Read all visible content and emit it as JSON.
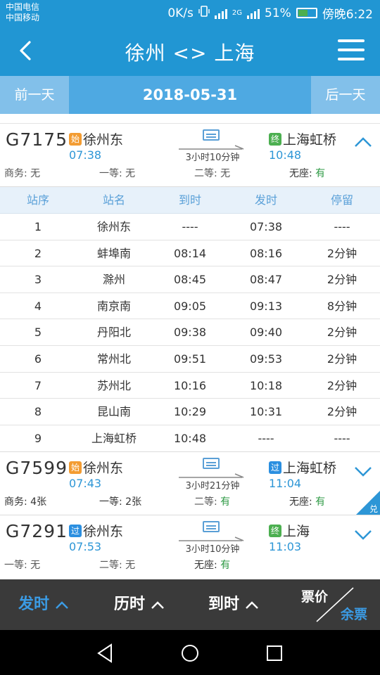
{
  "status_bar": {
    "carrier1": "中国电信",
    "carrier2": "中国移动",
    "speed": "0K/s",
    "net_label": "2G",
    "battery": "51%",
    "time": "傍晚6:22"
  },
  "app_bar": {
    "title": "徐州 <> 上海"
  },
  "date_bar": {
    "prev_label": "前一天",
    "date": "2018-05-31",
    "next_label": "后一天"
  },
  "trains": [
    {
      "code": "G7175",
      "from_tag": "始",
      "from": "徐州东",
      "dep_time": "07:38",
      "duration": "3小时10分钟",
      "to_tag": "终",
      "to": "上海虹桥",
      "arr_time": "10:48",
      "seats": [
        {
          "label": "商务: ",
          "value": "无"
        },
        {
          "label": "一等: ",
          "value": "无"
        },
        {
          "label": "二等: ",
          "value": "无"
        },
        {
          "label": "无座: ",
          "value": "有"
        }
      ],
      "expanded": true
    },
    {
      "code": "G7599",
      "from_tag": "始",
      "from": "徐州东",
      "dep_time": "07:43",
      "duration": "3小时21分钟",
      "to_tag": "过",
      "to": "上海虹桥",
      "arr_time": "11:04",
      "seats": [
        {
          "label": "商务: ",
          "value": "4张"
        },
        {
          "label": "一等: ",
          "value": "2张"
        },
        {
          "label": "二等: ",
          "value": "有"
        },
        {
          "label": "无座: ",
          "value": "有"
        }
      ],
      "corner_badge": "兑"
    },
    {
      "code": "G7291",
      "from_tag": "过",
      "from": "徐州东",
      "dep_time": "07:53",
      "duration": "3小时10分钟",
      "to_tag": "终",
      "to": "上海",
      "arr_time": "11:03",
      "seats": [
        {
          "label": "一等: ",
          "value": "无"
        },
        {
          "label": "二等: ",
          "value": "无"
        },
        {
          "label": "无座: ",
          "value": "有"
        }
      ]
    }
  ],
  "stop_table": {
    "headers": [
      "站序",
      "站名",
      "到时",
      "发时",
      "停留"
    ],
    "rows": [
      [
        "1",
        "徐州东",
        "----",
        "07:38",
        "----"
      ],
      [
        "2",
        "蚌埠南",
        "08:14",
        "08:16",
        "2分钟"
      ],
      [
        "3",
        "滁州",
        "08:45",
        "08:47",
        "2分钟"
      ],
      [
        "4",
        "南京南",
        "09:05",
        "09:13",
        "8分钟"
      ],
      [
        "5",
        "丹阳北",
        "09:38",
        "09:40",
        "2分钟"
      ],
      [
        "6",
        "常州北",
        "09:51",
        "09:53",
        "2分钟"
      ],
      [
        "7",
        "苏州北",
        "10:16",
        "10:18",
        "2分钟"
      ],
      [
        "8",
        "昆山南",
        "10:29",
        "10:31",
        "2分钟"
      ],
      [
        "9",
        "上海虹桥",
        "10:48",
        "----",
        "----"
      ]
    ]
  },
  "sort_bar": {
    "depart": "发时",
    "duration": "历时",
    "arrive": "到时",
    "price": "票价",
    "remaining": "余票"
  },
  "colors": {
    "primary": "#2196d3",
    "accent": "#3b9be4",
    "available": "#2e9a44"
  }
}
